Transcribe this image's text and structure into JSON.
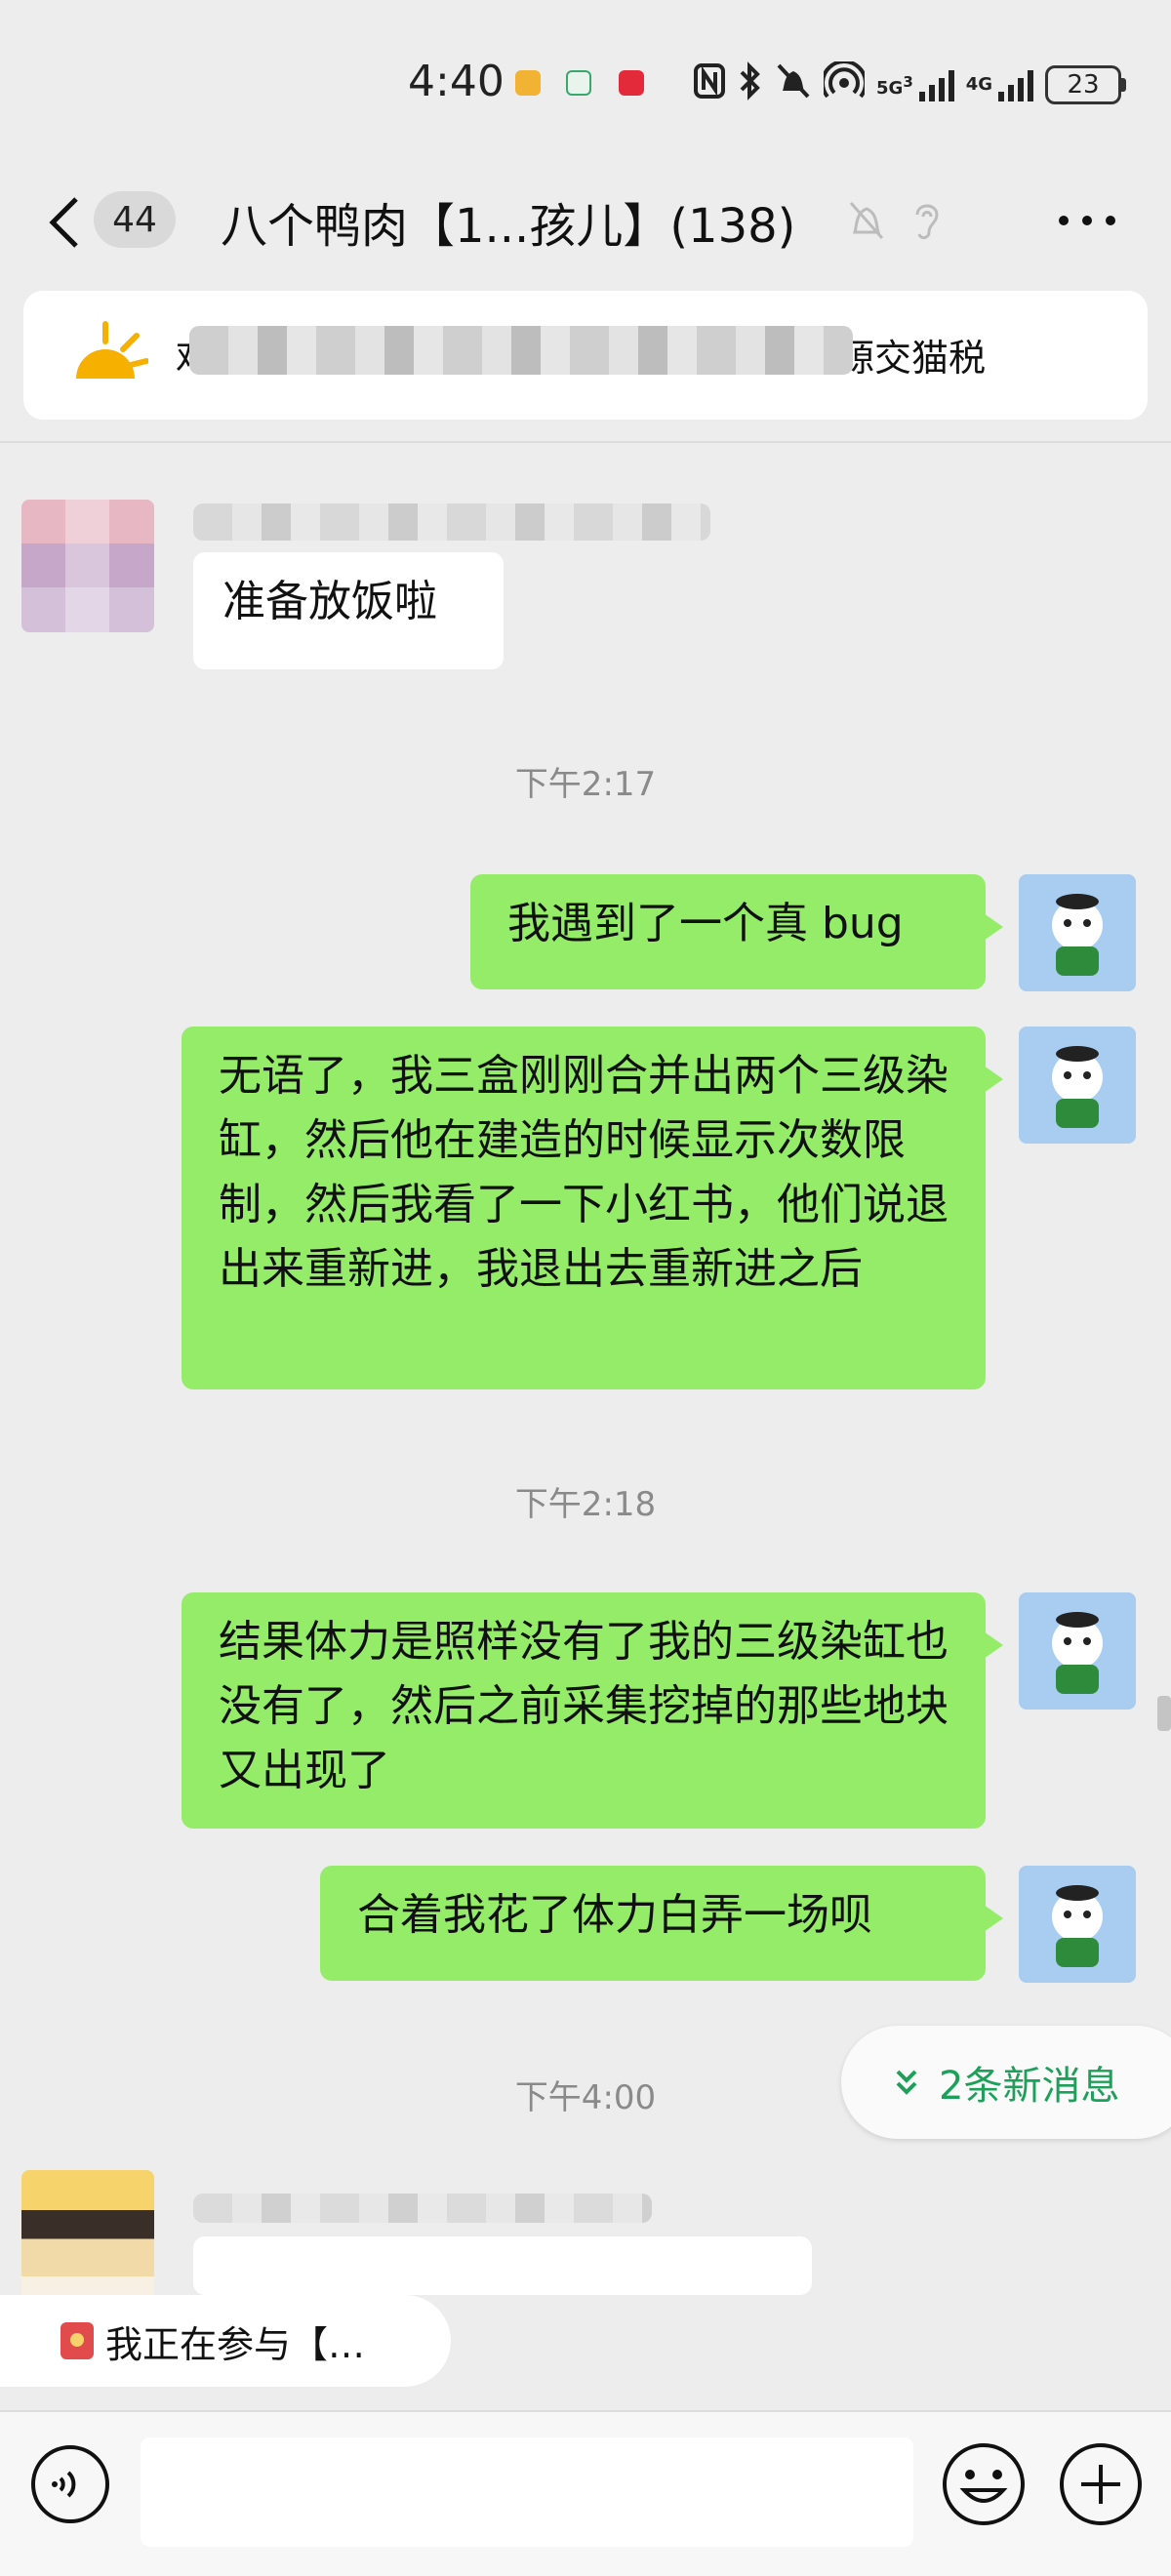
{
  "status_bar": {
    "time": "4:40",
    "net_5g": "5G",
    "net_4g": "4G",
    "sim_label": "3",
    "battery": "23"
  },
  "header": {
    "unread_count": "44",
    "title": "八个鸭肉【1...孩儿】(138)"
  },
  "notice": {
    "text_visible_tail": "源交猫税",
    "text_visible_head": "鸡"
  },
  "messages": [
    {
      "side": "left",
      "text": "准备放饭啦"
    },
    {
      "time": "下午2:17"
    },
    {
      "side": "right",
      "text": "我遇到了一个真 bug"
    },
    {
      "side": "right",
      "text": "无语了，我三盒刚刚合并出两个三级染缸，然后他在建造的时候显示次数限制，然后我看了一下小红书，他们说退出来重新进，我退出去重新进之后"
    },
    {
      "time": "下午2:18"
    },
    {
      "side": "right",
      "text": "结果体力是照样没有了我的三级染缸也没有了，然后之前采集挖掉的那些地块又出现了"
    },
    {
      "side": "right",
      "text": "合着我花了体力白弄一场呗"
    },
    {
      "time": "下午4:00"
    }
  ],
  "new_messages_label": "2条新消息",
  "system_tip": "我正在参与【…",
  "colors": {
    "bubble_green": "#95ec69",
    "background": "#ededed",
    "new_msg_text": "#1ea05a"
  }
}
